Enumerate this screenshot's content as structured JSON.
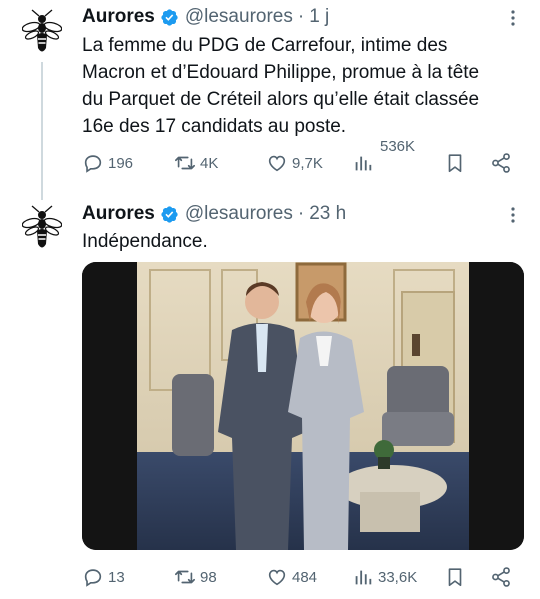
{
  "tweets": [
    {
      "author": "Aurores",
      "handle": "@lesaurores",
      "separator": "·",
      "time": "1 j",
      "text": "La femme du PDG de Carrefour, intime des Macron et d’Edouard Philippe, promue à la tête du Parquet de Créteil alors qu’elle était classée 16e des 17 candidats au poste.",
      "replies": "196",
      "retweets": "4K",
      "likes": "9,7K",
      "views": "536K"
    },
    {
      "author": "Aurores",
      "handle": "@lesaurores",
      "separator": "·",
      "time": "23 h",
      "text": "Indépendance.",
      "replies": "13",
      "retweets": "98",
      "likes": "484",
      "views": "33,6K"
    }
  ],
  "colors": {
    "verified": "#1d9bf0",
    "secondary": "#536471",
    "primary": "#0f1419"
  },
  "icons": [
    "bee-avatar-icon",
    "verified-badge-icon",
    "more-icon",
    "reply-icon",
    "retweet-icon",
    "like-icon",
    "views-icon",
    "bookmark-icon",
    "share-icon"
  ]
}
